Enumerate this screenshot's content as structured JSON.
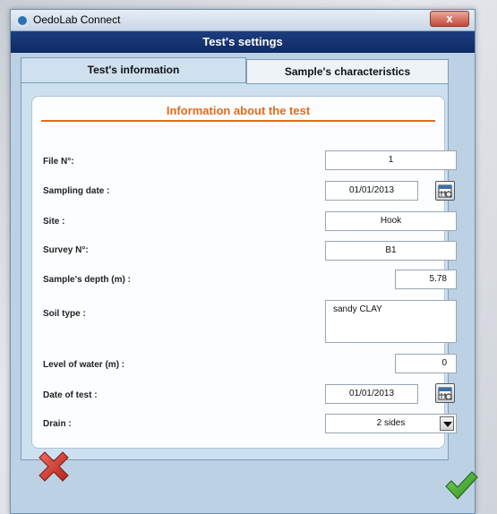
{
  "window": {
    "app_title": "OedoLab Connect",
    "close_glyph": "x",
    "header_title": "Test's settings"
  },
  "tabs": [
    {
      "label": "Test's information",
      "active": true
    },
    {
      "label": "Sample's characteristics",
      "active": false
    }
  ],
  "section": {
    "title": "Information about the test",
    "accent_color": "#e36b1d"
  },
  "form": {
    "file_no": {
      "label": "File N°:",
      "value": "1"
    },
    "sampling_date": {
      "label": "Sampling date :",
      "value": "01/01/2013"
    },
    "site": {
      "label": "Site :",
      "value": "Hook"
    },
    "survey_no": {
      "label": "Survey N°:",
      "value": "B1"
    },
    "sample_depth": {
      "label": "Sample's depth (m) :",
      "value": "5.78"
    },
    "soil_type": {
      "label": "Soil type :",
      "value": "sandy CLAY"
    },
    "water_level": {
      "label": "Level of water (m) :",
      "value": "0"
    },
    "test_date": {
      "label": "Date of test :",
      "value": "01/01/2013"
    },
    "drain": {
      "label": "Drain :",
      "value": "2 sides"
    }
  },
  "icons": {
    "calendar": "calendar-icon",
    "cancel": "cancel-x-icon",
    "confirm": "checkmark-icon"
  }
}
